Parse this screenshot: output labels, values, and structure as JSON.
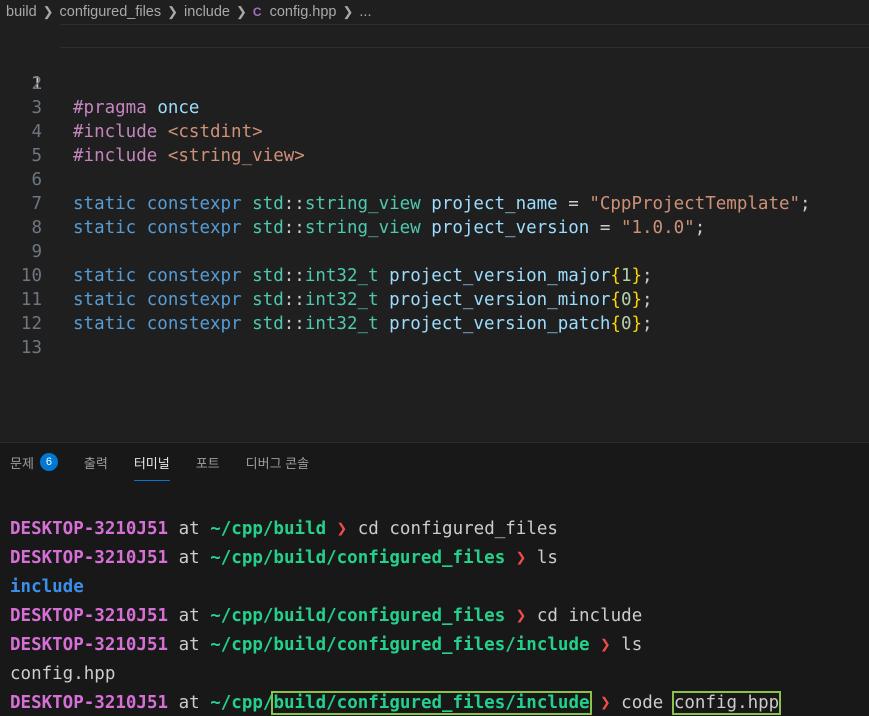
{
  "breadcrumb": {
    "items": [
      "build",
      "configured_files",
      "include",
      "config.hpp",
      "..."
    ],
    "file_icon": "C"
  },
  "editor": {
    "active_line": 1,
    "lines": [
      {
        "n": "1"
      },
      {
        "n": "2"
      },
      {
        "n": "3"
      },
      {
        "n": "4"
      },
      {
        "n": "5"
      },
      {
        "n": "6"
      },
      {
        "n": "7"
      },
      {
        "n": "8"
      },
      {
        "n": "9"
      },
      {
        "n": "10"
      },
      {
        "n": "11"
      },
      {
        "n": "12"
      },
      {
        "n": "13"
      }
    ],
    "code": {
      "l1": {
        "directive": "#pragma",
        "arg": "once"
      },
      "l3": {
        "directive": "#include",
        "header": "<cstdint>"
      },
      "l4": {
        "directive": "#include",
        "header": "<string_view>"
      },
      "l6": {
        "static": "static",
        "constexpr": "constexpr",
        "ns": "std",
        "sep": "::",
        "type": "string_view",
        "name": "project_name",
        "eq": " = ",
        "value": "\"CppProjectTemplate\"",
        "end": ";"
      },
      "l7": {
        "static": "static",
        "constexpr": "constexpr",
        "ns": "std",
        "sep": "::",
        "type": "string_view",
        "name": "project_version",
        "eq": " = ",
        "value": "\"1.0.0\"",
        "end": ";"
      },
      "l9": {
        "static": "static",
        "constexpr": "constexpr",
        "ns": "std",
        "sep": "::",
        "type": "int32_t",
        "name": "project_version_major",
        "open": "{",
        "value": "1",
        "close": "}",
        "end": ";"
      },
      "l10": {
        "static": "static",
        "constexpr": "constexpr",
        "ns": "std",
        "sep": "::",
        "type": "int32_t",
        "name": "project_version_minor",
        "open": "{",
        "value": "0",
        "close": "}",
        "end": ";"
      },
      "l11": {
        "static": "static",
        "constexpr": "constexpr",
        "ns": "std",
        "sep": "::",
        "type": "int32_t",
        "name": "project_version_patch",
        "open": "{",
        "value": "0",
        "close": "}",
        "end": ";"
      }
    }
  },
  "panel": {
    "tabs": [
      {
        "label": "문제",
        "badge": "6"
      },
      {
        "label": "출력"
      },
      {
        "label": "터미널",
        "active": true
      },
      {
        "label": "포트"
      },
      {
        "label": "디버그 콘솔"
      }
    ]
  },
  "terminal": {
    "host": "DESKTOP-3210J51",
    "at": "at",
    "arrow": "❯",
    "lines": [
      {
        "path": "~/cpp/build",
        "cmd": "cd configured_files"
      },
      {
        "path": "~/cpp/build/configured_files",
        "cmd": "ls"
      },
      {
        "output": "include"
      },
      {
        "path": "~/cpp/build/configured_files",
        "cmd": "cd include"
      },
      {
        "path": "~/cpp/build/configured_files/include",
        "cmd": "ls"
      },
      {
        "output": "config.hpp"
      },
      {
        "path_prefix": "~/cpp/",
        "path_highlight": "build/configured_files/include",
        "cmd": "code",
        "cmd_arg": "config.hpp"
      }
    ]
  },
  "colors": {
    "highlight_box": "#8bc34a",
    "accent": "#0078d4",
    "host": "#d670d6",
    "path": "#23d18b"
  }
}
